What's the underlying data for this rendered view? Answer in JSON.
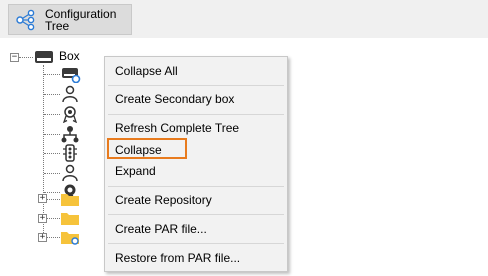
{
  "toolbar": {
    "config_tree_label_line1": "Configuration",
    "config_tree_label_line2": "Tree"
  },
  "tree": {
    "root_label": "Box",
    "expand_symbol": "+",
    "collapse_symbol": "−"
  },
  "context_menu": {
    "items": [
      "Collapse All",
      "Create Secondary box",
      "Refresh Complete Tree",
      "Collapse",
      "Expand",
      "Create Repository",
      "Create PAR file...",
      "Restore from PAR file..."
    ],
    "highlighted_item": "Collapse"
  },
  "colors": {
    "highlight_border": "#e87b1e",
    "folder": "#f6c33b",
    "icon_blue": "#2b7bd6"
  }
}
